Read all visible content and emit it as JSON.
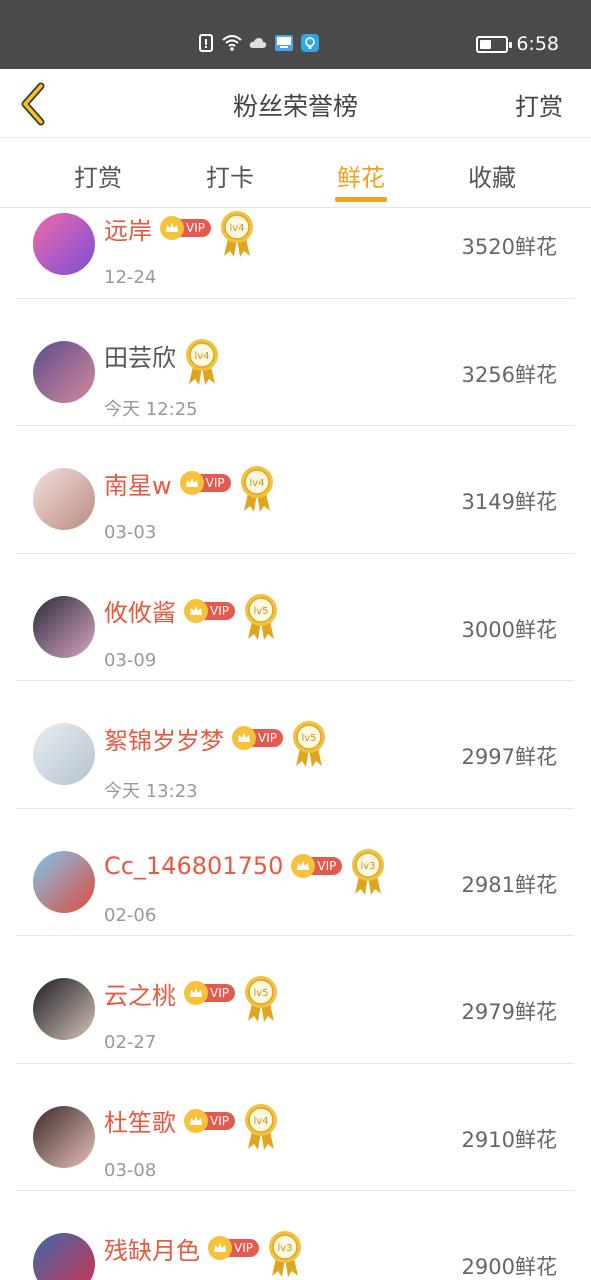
{
  "status_bar": {
    "time": "6:58",
    "battery_level": 0.45,
    "icons": [
      "alert-icon",
      "wifi-icon",
      "cloud-icon",
      "image-app-icon",
      "tips-app-icon"
    ]
  },
  "header": {
    "title": "粉丝荣誉榜",
    "right_action": "打赏"
  },
  "tabs": [
    {
      "label": "打赏",
      "active": false
    },
    {
      "label": "打卡",
      "active": false
    },
    {
      "label": "鲜花",
      "active": true
    },
    {
      "label": "收藏",
      "active": false
    }
  ],
  "vip_label": "VIP",
  "colors": {
    "accent": "#f3a11c",
    "name_vip": "#e85a40",
    "name_plain": "#555555",
    "vip_badge": "#e55a4e",
    "status_bar": "#4a4a4a"
  },
  "fans": [
    {
      "name": "远岸",
      "vip": true,
      "level": "lv4",
      "date": "12-24",
      "score": "3520鲜花"
    },
    {
      "name": "田芸欣",
      "vip": false,
      "level": "lv4",
      "date": "今天 12:25",
      "score": "3256鲜花"
    },
    {
      "name": "南星w",
      "vip": true,
      "level": "lv4",
      "date": "03-03",
      "score": "3149鲜花"
    },
    {
      "name": "攸攸酱",
      "vip": true,
      "level": "lv5",
      "date": "03-09",
      "score": "3000鲜花"
    },
    {
      "name": "絮锦岁岁梦",
      "vip": true,
      "level": "lv5",
      "date": "今天 13:23",
      "score": "2997鲜花"
    },
    {
      "name": "Cc_146801750",
      "vip": true,
      "level": "lv3",
      "date": "02-06",
      "score": "2981鲜花"
    },
    {
      "name": "云之桃",
      "vip": true,
      "level": "lv5",
      "date": "02-27",
      "score": "2979鲜花"
    },
    {
      "name": "杜笙歌",
      "vip": true,
      "level": "lv4",
      "date": "03-08",
      "score": "2910鲜花"
    },
    {
      "name": "残缺月色",
      "vip": true,
      "level": "lv3",
      "date": "",
      "score": "2900鲜花"
    }
  ]
}
